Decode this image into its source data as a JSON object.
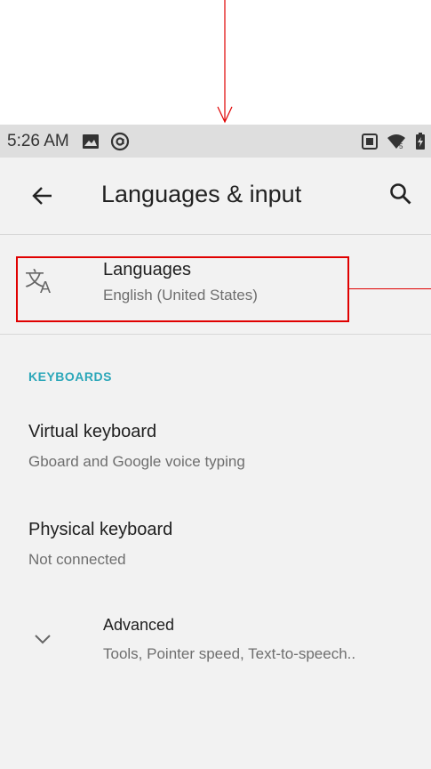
{
  "status_bar": {
    "time": "5:26 AM",
    "left_icons": [
      "image-icon",
      "at-sign-icon"
    ],
    "right_icons": [
      "screen-icon",
      "wifi-icon",
      "battery-charging-icon"
    ]
  },
  "app_bar": {
    "title": "Languages & input",
    "back_icon": "arrow-back-icon",
    "search_icon": "search-icon"
  },
  "languages_item": {
    "title": "Languages",
    "subtitle": "English (United States)",
    "icon": "translate-icon"
  },
  "keyboards_section": {
    "header": "KEYBOARDS",
    "items": [
      {
        "title": "Virtual keyboard",
        "subtitle": "Gboard and Google voice typing"
      },
      {
        "title": "Physical keyboard",
        "subtitle": "Not connected"
      }
    ]
  },
  "advanced_item": {
    "title": "Advanced",
    "subtitle": "Tools, Pointer speed, Text-to-speech..",
    "icon": "chevron-down-icon"
  },
  "annotation": {
    "color": "#e00000"
  },
  "colors": {
    "accent": "#2ba7b9",
    "background": "#f2f2f2",
    "status_bar": "#dedede"
  }
}
